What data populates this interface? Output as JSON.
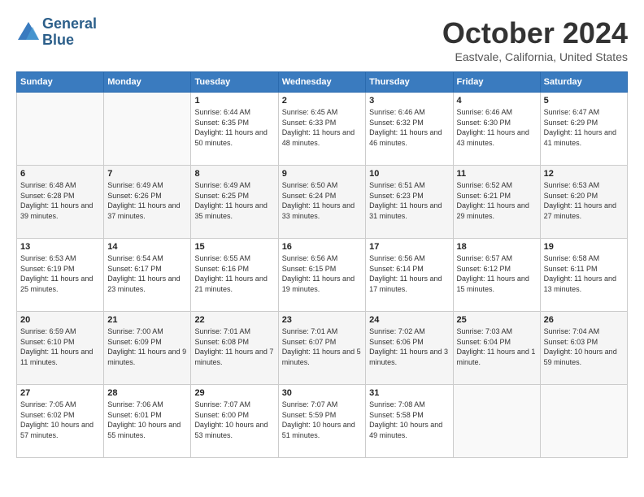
{
  "header": {
    "logo_line1": "General",
    "logo_line2": "Blue",
    "month": "October 2024",
    "location": "Eastvale, California, United States"
  },
  "weekdays": [
    "Sunday",
    "Monday",
    "Tuesday",
    "Wednesday",
    "Thursday",
    "Friday",
    "Saturday"
  ],
  "weeks": [
    [
      {
        "day": "",
        "info": ""
      },
      {
        "day": "",
        "info": ""
      },
      {
        "day": "1",
        "info": "Sunrise: 6:44 AM\nSunset: 6:35 PM\nDaylight: 11 hours and 50 minutes."
      },
      {
        "day": "2",
        "info": "Sunrise: 6:45 AM\nSunset: 6:33 PM\nDaylight: 11 hours and 48 minutes."
      },
      {
        "day": "3",
        "info": "Sunrise: 6:46 AM\nSunset: 6:32 PM\nDaylight: 11 hours and 46 minutes."
      },
      {
        "day": "4",
        "info": "Sunrise: 6:46 AM\nSunset: 6:30 PM\nDaylight: 11 hours and 43 minutes."
      },
      {
        "day": "5",
        "info": "Sunrise: 6:47 AM\nSunset: 6:29 PM\nDaylight: 11 hours and 41 minutes."
      }
    ],
    [
      {
        "day": "6",
        "info": "Sunrise: 6:48 AM\nSunset: 6:28 PM\nDaylight: 11 hours and 39 minutes."
      },
      {
        "day": "7",
        "info": "Sunrise: 6:49 AM\nSunset: 6:26 PM\nDaylight: 11 hours and 37 minutes."
      },
      {
        "day": "8",
        "info": "Sunrise: 6:49 AM\nSunset: 6:25 PM\nDaylight: 11 hours and 35 minutes."
      },
      {
        "day": "9",
        "info": "Sunrise: 6:50 AM\nSunset: 6:24 PM\nDaylight: 11 hours and 33 minutes."
      },
      {
        "day": "10",
        "info": "Sunrise: 6:51 AM\nSunset: 6:23 PM\nDaylight: 11 hours and 31 minutes."
      },
      {
        "day": "11",
        "info": "Sunrise: 6:52 AM\nSunset: 6:21 PM\nDaylight: 11 hours and 29 minutes."
      },
      {
        "day": "12",
        "info": "Sunrise: 6:53 AM\nSunset: 6:20 PM\nDaylight: 11 hours and 27 minutes."
      }
    ],
    [
      {
        "day": "13",
        "info": "Sunrise: 6:53 AM\nSunset: 6:19 PM\nDaylight: 11 hours and 25 minutes."
      },
      {
        "day": "14",
        "info": "Sunrise: 6:54 AM\nSunset: 6:17 PM\nDaylight: 11 hours and 23 minutes."
      },
      {
        "day": "15",
        "info": "Sunrise: 6:55 AM\nSunset: 6:16 PM\nDaylight: 11 hours and 21 minutes."
      },
      {
        "day": "16",
        "info": "Sunrise: 6:56 AM\nSunset: 6:15 PM\nDaylight: 11 hours and 19 minutes."
      },
      {
        "day": "17",
        "info": "Sunrise: 6:56 AM\nSunset: 6:14 PM\nDaylight: 11 hours and 17 minutes."
      },
      {
        "day": "18",
        "info": "Sunrise: 6:57 AM\nSunset: 6:12 PM\nDaylight: 11 hours and 15 minutes."
      },
      {
        "day": "19",
        "info": "Sunrise: 6:58 AM\nSunset: 6:11 PM\nDaylight: 11 hours and 13 minutes."
      }
    ],
    [
      {
        "day": "20",
        "info": "Sunrise: 6:59 AM\nSunset: 6:10 PM\nDaylight: 11 hours and 11 minutes."
      },
      {
        "day": "21",
        "info": "Sunrise: 7:00 AM\nSunset: 6:09 PM\nDaylight: 11 hours and 9 minutes."
      },
      {
        "day": "22",
        "info": "Sunrise: 7:01 AM\nSunset: 6:08 PM\nDaylight: 11 hours and 7 minutes."
      },
      {
        "day": "23",
        "info": "Sunrise: 7:01 AM\nSunset: 6:07 PM\nDaylight: 11 hours and 5 minutes."
      },
      {
        "day": "24",
        "info": "Sunrise: 7:02 AM\nSunset: 6:06 PM\nDaylight: 11 hours and 3 minutes."
      },
      {
        "day": "25",
        "info": "Sunrise: 7:03 AM\nSunset: 6:04 PM\nDaylight: 11 hours and 1 minute."
      },
      {
        "day": "26",
        "info": "Sunrise: 7:04 AM\nSunset: 6:03 PM\nDaylight: 10 hours and 59 minutes."
      }
    ],
    [
      {
        "day": "27",
        "info": "Sunrise: 7:05 AM\nSunset: 6:02 PM\nDaylight: 10 hours and 57 minutes."
      },
      {
        "day": "28",
        "info": "Sunrise: 7:06 AM\nSunset: 6:01 PM\nDaylight: 10 hours and 55 minutes."
      },
      {
        "day": "29",
        "info": "Sunrise: 7:07 AM\nSunset: 6:00 PM\nDaylight: 10 hours and 53 minutes."
      },
      {
        "day": "30",
        "info": "Sunrise: 7:07 AM\nSunset: 5:59 PM\nDaylight: 10 hours and 51 minutes."
      },
      {
        "day": "31",
        "info": "Sunrise: 7:08 AM\nSunset: 5:58 PM\nDaylight: 10 hours and 49 minutes."
      },
      {
        "day": "",
        "info": ""
      },
      {
        "day": "",
        "info": ""
      }
    ]
  ]
}
